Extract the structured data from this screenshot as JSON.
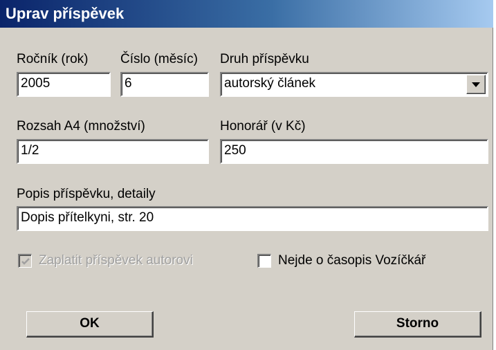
{
  "window": {
    "title": "Uprav příspěvek"
  },
  "form": {
    "rocnik": {
      "label": "Ročník (rok)",
      "value": "2005"
    },
    "cislo": {
      "label": "Číslo (měsíc)",
      "value": "6"
    },
    "druh": {
      "label": "Druh příspěvku",
      "value": "autorský článek"
    },
    "rozsah": {
      "label": "Rozsah A4 (množství)",
      "value": "1/2"
    },
    "honorar": {
      "label": "Honorář (v Kč)",
      "value": "250"
    },
    "popis": {
      "label": "Popis příspěvku, detaily",
      "value": "Dopis přítelkyni, str. 20"
    },
    "zaplatit": {
      "label": "Zaplatit příspěvek autorovi",
      "checked": true,
      "enabled": false
    },
    "nejde": {
      "label": "Nejde o časopis Vozíčkář",
      "checked": false,
      "enabled": true
    }
  },
  "buttons": {
    "ok": "OK",
    "storno": "Storno"
  },
  "icons": {
    "dropdown": "chevron-down-icon",
    "check": "checkmark-icon"
  },
  "colors": {
    "titlebar_start": "#0a246a",
    "titlebar_end": "#a6caf0",
    "dialog_bg": "#d4d0c8"
  }
}
